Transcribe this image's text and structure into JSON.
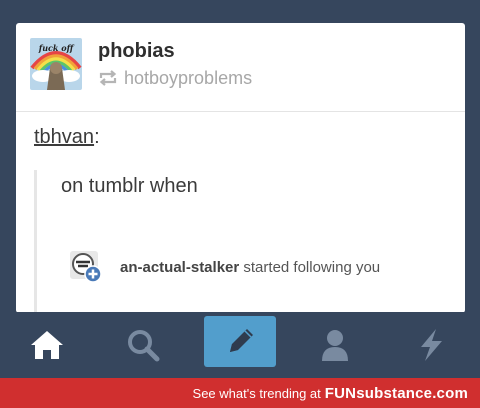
{
  "post": {
    "blog_name": "phobias",
    "reblogged_from": "hotboyproblems",
    "avatar_text": "fuck off",
    "source_user": "tbhvan",
    "source_colon": ":",
    "quote": "on tumblr when",
    "notification": {
      "username": "an-actual-stalker",
      "action": "started following you"
    }
  },
  "tab_bar": {
    "icons": [
      "home-icon",
      "search-icon",
      "compose-icon",
      "account-icon",
      "activity-icon"
    ],
    "active_color": "#ffffff",
    "inactive_color": "#798aa0",
    "compose_color": "#529ecc"
  },
  "footer": {
    "text": "See what's trending at",
    "brand": "FUNsubstance.com",
    "color": "#d02f2f"
  },
  "colors": {
    "background": "#36465d",
    "card": "#ffffff"
  }
}
